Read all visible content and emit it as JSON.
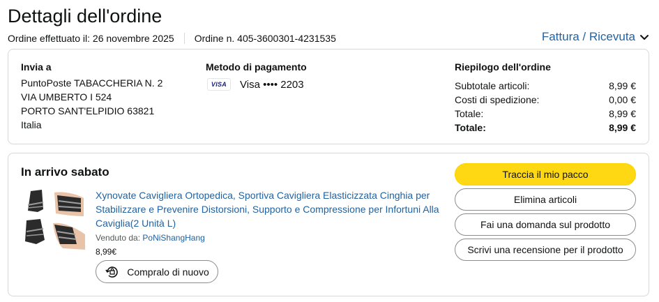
{
  "header": {
    "title": "Dettagli dell'ordine",
    "order_date": "Ordine effettuato il: 26 novembre 2025",
    "order_number": "Ordine n. 405-3600301-4231535",
    "invoice_link": "Fattura / Ricevuta"
  },
  "shipping": {
    "heading": "Invia a",
    "lines": [
      "PuntoPoste TABACCHERIA N. 2",
      "VIA UMBERTO I 524",
      "PORTO SANT'ELPIDIO 63821",
      "Italia"
    ]
  },
  "payment": {
    "heading": "Metodo di pagamento",
    "card_brand": "VISA",
    "card_text": "Visa •••• 2203"
  },
  "summary": {
    "heading": "Riepilogo dell'ordine",
    "rows": [
      {
        "label": "Subtotale articoli:",
        "value": "8,99 €"
      },
      {
        "label": "Costi di spedizione:",
        "value": "0,00 €"
      },
      {
        "label": "Totale:",
        "value": "8,99 €"
      },
      {
        "label": "Totale:",
        "value": "8,99 €"
      }
    ]
  },
  "shipment": {
    "status": "In arrivo sabato",
    "product_title": "Xynovate Cavigliera Ortopedica, Sportiva Cavigliera Elasticizzata Cinghia per Stabilizzare e Prevenire Distorsioni, Supporto e Compressione per Infortuni Alla Caviglia(2 Unità L)",
    "sold_by_label": "Venduto da:",
    "seller": "PoNiShangHang",
    "price": "8,99€",
    "rebuy_label": "Compralo di nuovo"
  },
  "actions": {
    "track": "Traccia il mio pacco",
    "delete": "Elimina articoli",
    "question": "Fai una domanda sul prodotto",
    "review": "Scrivi una recensione per il prodotto"
  },
  "colors": {
    "link": "#2162a1",
    "primary_button": "#ffd814",
    "border": "#d5d9d9",
    "text": "#0f1111"
  }
}
